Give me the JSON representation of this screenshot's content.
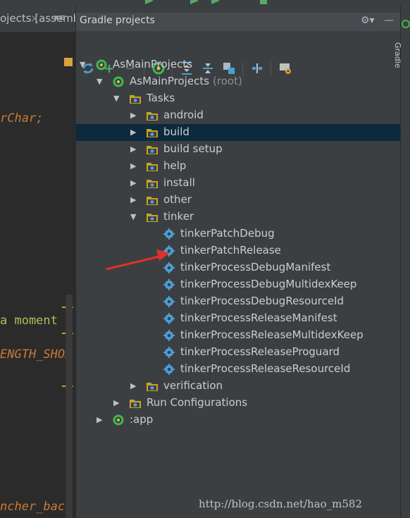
{
  "editor": {
    "tab_label": "ojects [assembleRelease]",
    "tab_close": "×",
    "tab_menu": "▾≡",
    "code_lines": [
      {
        "text": "rChar;",
        "style": "italic"
      },
      {
        "text": "a moment \"",
        "style": "green"
      },
      {
        "text": "ENGTH_SHOR",
        "style": "italic"
      },
      {
        "text": "ncher_back",
        "style": "italic"
      }
    ]
  },
  "gradle": {
    "title": "Gradle projects",
    "header_icons": {
      "settings": "gear-icon",
      "hide": "minimize-icon"
    },
    "toolbar": [
      "refresh-icon",
      "add-icon",
      "remove-icon",
      "execute-task-icon",
      "expand-all-icon",
      "collapse-all-icon",
      "group-modules-icon",
      "link-icon",
      "gradle-settings-icon"
    ],
    "tree": [
      {
        "label": "AsMainProjects",
        "level": 0,
        "arrow": "expanded",
        "icon": "gradle"
      },
      {
        "label": "AsMainProjects",
        "suffix": "(root)",
        "level": 1,
        "arrow": "expanded",
        "icon": "gradle"
      },
      {
        "label": "Tasks",
        "level": 2,
        "arrow": "expanded",
        "icon": "folder"
      },
      {
        "label": "android",
        "level": 3,
        "arrow": "collapsed",
        "icon": "folder"
      },
      {
        "label": "build",
        "level": 3,
        "arrow": "collapsed",
        "icon": "folder",
        "selected": true
      },
      {
        "label": "build setup",
        "level": 3,
        "arrow": "collapsed",
        "icon": "folder"
      },
      {
        "label": "help",
        "level": 3,
        "arrow": "collapsed",
        "icon": "folder"
      },
      {
        "label": "install",
        "level": 3,
        "arrow": "collapsed",
        "icon": "folder"
      },
      {
        "label": "other",
        "level": 3,
        "arrow": "collapsed",
        "icon": "folder"
      },
      {
        "label": "tinker",
        "level": 3,
        "arrow": "expanded",
        "icon": "folder"
      },
      {
        "label": "tinkerPatchDebug",
        "level": 4,
        "arrow": "none",
        "icon": "gear"
      },
      {
        "label": "tinkerPatchRelease",
        "level": 4,
        "arrow": "none",
        "icon": "gear"
      },
      {
        "label": "tinkerProcessDebugManifest",
        "level": 4,
        "arrow": "none",
        "icon": "gear"
      },
      {
        "label": "tinkerProcessDebugMultidexKeep",
        "level": 4,
        "arrow": "none",
        "icon": "gear"
      },
      {
        "label": "tinkerProcessDebugResourceId",
        "level": 4,
        "arrow": "none",
        "icon": "gear"
      },
      {
        "label": "tinkerProcessReleaseManifest",
        "level": 4,
        "arrow": "none",
        "icon": "gear"
      },
      {
        "label": "tinkerProcessReleaseMultidexKeep",
        "level": 4,
        "arrow": "none",
        "icon": "gear"
      },
      {
        "label": "tinkerProcessReleaseProguard",
        "level": 4,
        "arrow": "none",
        "icon": "gear"
      },
      {
        "label": "tinkerProcessReleaseResourceId",
        "level": 4,
        "arrow": "none",
        "icon": "gear"
      },
      {
        "label": "verification",
        "level": 3,
        "arrow": "collapsed",
        "icon": "folder"
      },
      {
        "label": "Run Configurations",
        "level": 2,
        "arrow": "collapsed",
        "icon": "folder"
      },
      {
        "label": ":app",
        "level": 1,
        "arrow": "collapsed",
        "icon": "gradle"
      }
    ]
  },
  "side_strip": {
    "label": "Gradle"
  },
  "watermark": "http://blog.csdn.net/hao_m582",
  "colors": {
    "panel_bg": "#3c3f41",
    "editor_bg": "#2b2b2b",
    "selection": "#0d293e",
    "annotation_arrow": "#e0302a",
    "folder": "#c9a227",
    "gradle_green": "#3fb950",
    "task_gear": "#4a9fd8"
  }
}
